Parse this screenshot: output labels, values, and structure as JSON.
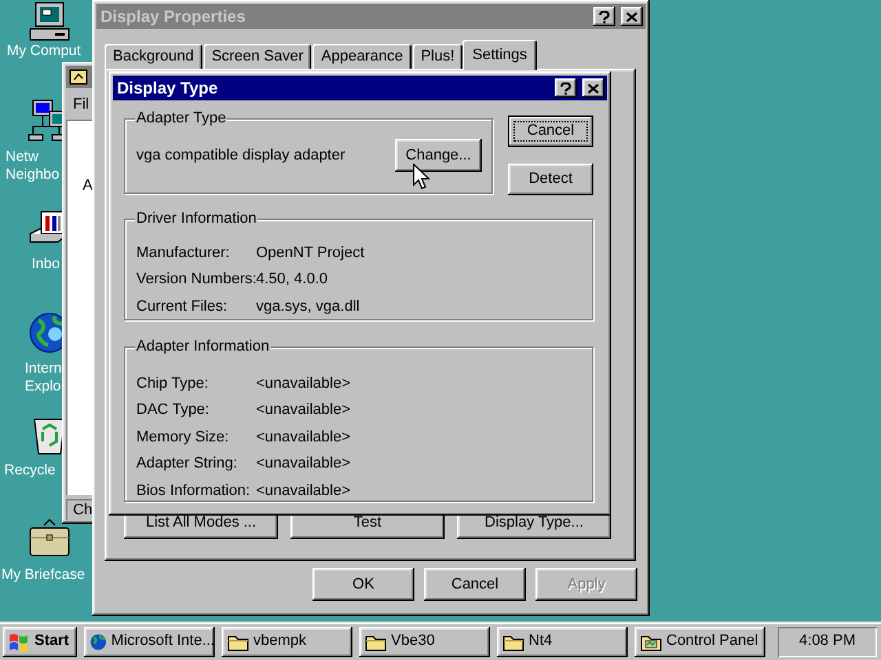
{
  "desktop_icons": [
    {
      "kind": "computer",
      "label": "My Comput"
    },
    {
      "kind": "network",
      "label": "Netw\nNeighbo"
    },
    {
      "kind": "inbox",
      "label": "Inbo"
    },
    {
      "kind": "globe",
      "label": "Intern\nExplo"
    },
    {
      "kind": "recycle",
      "label": "Recycle"
    },
    {
      "kind": "briefcase",
      "label": "My Briefcase"
    }
  ],
  "background_window": {
    "menu": "Fil",
    "content": "A",
    "status": "Ch"
  },
  "display_properties": {
    "title": "Display Properties",
    "tabs": [
      {
        "label": "Background",
        "selected": false
      },
      {
        "label": "Screen Saver",
        "selected": false
      },
      {
        "label": "Appearance",
        "selected": false
      },
      {
        "label": "Plus!",
        "selected": false
      },
      {
        "label": "Settings",
        "selected": true
      }
    ],
    "panel_buttons": [
      {
        "label": "List All Modes ..."
      },
      {
        "label": "Test"
      },
      {
        "label": "Display Type..."
      }
    ],
    "buttons": [
      {
        "label": "OK",
        "disabled": false
      },
      {
        "label": "Cancel",
        "disabled": false
      },
      {
        "label": "Apply",
        "disabled": true
      }
    ]
  },
  "display_type": {
    "title": "Display Type",
    "adapter_type": {
      "title": "Adapter Type",
      "value": "vga compatible display adapter",
      "button": "Change..."
    },
    "buttons": [
      {
        "label": "Cancel",
        "default": true
      },
      {
        "label": "Detect",
        "default": false
      }
    ],
    "driver_information": {
      "title": "Driver Information",
      "rows": [
        {
          "label": "Manufacturer:",
          "value": "OpenNT Project"
        },
        {
          "label": "Version Numbers:",
          "value": "4.50, 4.0.0"
        },
        {
          "label": "Current Files:",
          "value": "vga.sys, vga.dll"
        }
      ]
    },
    "adapter_information": {
      "title": "Adapter Information",
      "rows": [
        {
          "label": "Chip Type:",
          "value": "<unavailable>"
        },
        {
          "label": "DAC Type:",
          "value": "<unavailable>"
        },
        {
          "label": "Memory Size:",
          "value": "<unavailable>"
        },
        {
          "label": "Adapter String:",
          "value": "<unavailable>"
        },
        {
          "label": "Bios Information:",
          "value": "<unavailable>"
        }
      ]
    }
  },
  "taskbar": {
    "start": "Start",
    "tasks": [
      {
        "kind": "browser",
        "label": "Microsoft Inte...",
        "selected": false
      },
      {
        "kind": "folder",
        "label": "vbempk",
        "selected": false
      },
      {
        "kind": "folder",
        "label": "Vbe30",
        "selected": false
      },
      {
        "kind": "folder",
        "label": "Nt4",
        "selected": false
      },
      {
        "kind": "control",
        "label": "Control Panel",
        "selected": false
      }
    ],
    "clock": "4:08 PM"
  }
}
